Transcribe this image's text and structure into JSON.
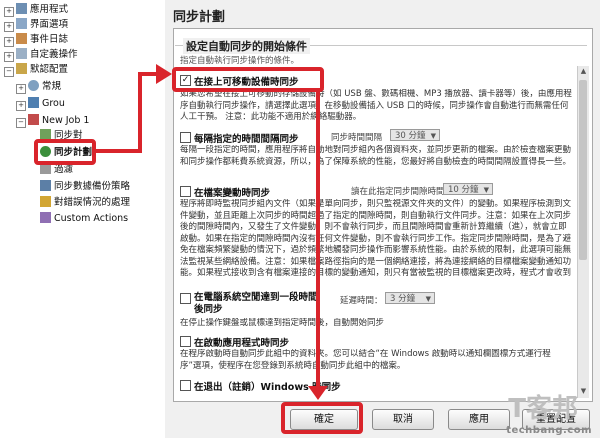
{
  "tree": {
    "items": [
      {
        "label": "應用程式"
      },
      {
        "label": "界面選項"
      },
      {
        "label": "事件日誌"
      },
      {
        "label": "自定義操作"
      },
      {
        "label": "默認配置"
      },
      {
        "label": "常規"
      },
      {
        "label": "Grou"
      },
      {
        "label": "New Job 1"
      },
      {
        "label": "同步對"
      },
      {
        "label": "同步計劃"
      },
      {
        "label": "過濾"
      },
      {
        "label": "同步數據備份策略"
      },
      {
        "label": "對錯誤情況的處理"
      },
      {
        "label": "Custom Actions"
      }
    ]
  },
  "dialog": {
    "title": "同步計劃",
    "section_title": "設定自動同步的開始條件",
    "hint": "指定自動執行同步操作的條件。",
    "options": [
      {
        "label": "在接上可移動設備時同步",
        "checked": true,
        "desc": "如果您希望在接上可移動的存儲設備時（如 USB 盤、數碼相機、MP3 播放器、讀卡器等）後，由應用程序自動執行同步操作，請選擇此選項。在移動設備插入 USB 口的時候，同步操作會自動進行而無需任何人工干預。  注意：此功能不適用於網絡驅動器。"
      },
      {
        "label": "每隔指定的時間間隔同步",
        "checked": false,
        "field_label": "同步時間間隔",
        "field_value": "30 分鐘",
        "desc": "每隔一段指定的時間，應用程序將自動地對同步組內各個資料夾，並同步更新的檔案。由於檢查檔案更動和同步操作都耗費系統資源，所以，為了保障系統的性能，您最好將自動檢查的時間間隔設置得長一些。"
      },
      {
        "label": "在檔案變動時同步",
        "checked": false,
        "field_label": "讀在此指定同步間隙時間",
        "field_value": "10 分鐘",
        "desc": "程序將即時監視同步組內文件（如果是單向同步，則只監視源文件夾的文件）的變動。如果程序檢測到文件變動，並且距離上次同步的時間超過了指定的間隙時間，則自動執行文件同步。注意：如果在上次同步後的間隙時間內，又發生了文件變動，則不會執行同步，而且間隙時間會重新計算繼續（進），就會立即啟動。如果在指定的間隙時間內沒有任何文件變動，則不會執行同步工作。指定同步間隙時間，是為了避免在檔案頻繁變動的情況下，過於頻繁地觸發同步操作而影響系統性能。由於系統的限制，此選項可能無法監視某些網絡設備。注意：如果檔案路徑指向的是一個網絡連接，將為連接網絡的目標檔案變動通知功能。如果程式接收到含有檔案連接的目標的變動通知，則只有當被監視的目標檔案更改時，程式才會收到檔案變動通知。"
      },
      {
        "label": "在電腦系統空閒達到一段時間後同步",
        "checked": false,
        "field_label": "延遲時間：",
        "field_value": "3 分鐘",
        "desc": "在停止操作鍵盤或鼠標達到指定時間後，自動開始同步"
      },
      {
        "label": "在啟動應用程式時同步",
        "checked": false,
        "desc": "在程序啟動時自動同步此組中的資料夾。您可以結合“在 Windows 啟動時以通知欄圖標方式運行程序”選項，使程序在您登錄到系統時自動同步此組中的檔案。"
      },
      {
        "label": "在退出（註銷）Windows 時同步",
        "checked": false,
        "desc": ""
      }
    ],
    "buttons": {
      "ok": "確定",
      "cancel": "取消",
      "apply": "應用",
      "reset": "重置配置"
    }
  },
  "watermark": {
    "text": "techbang.com",
    "logo": "T客邦"
  },
  "colors": {
    "highlight": "#d9242b"
  }
}
